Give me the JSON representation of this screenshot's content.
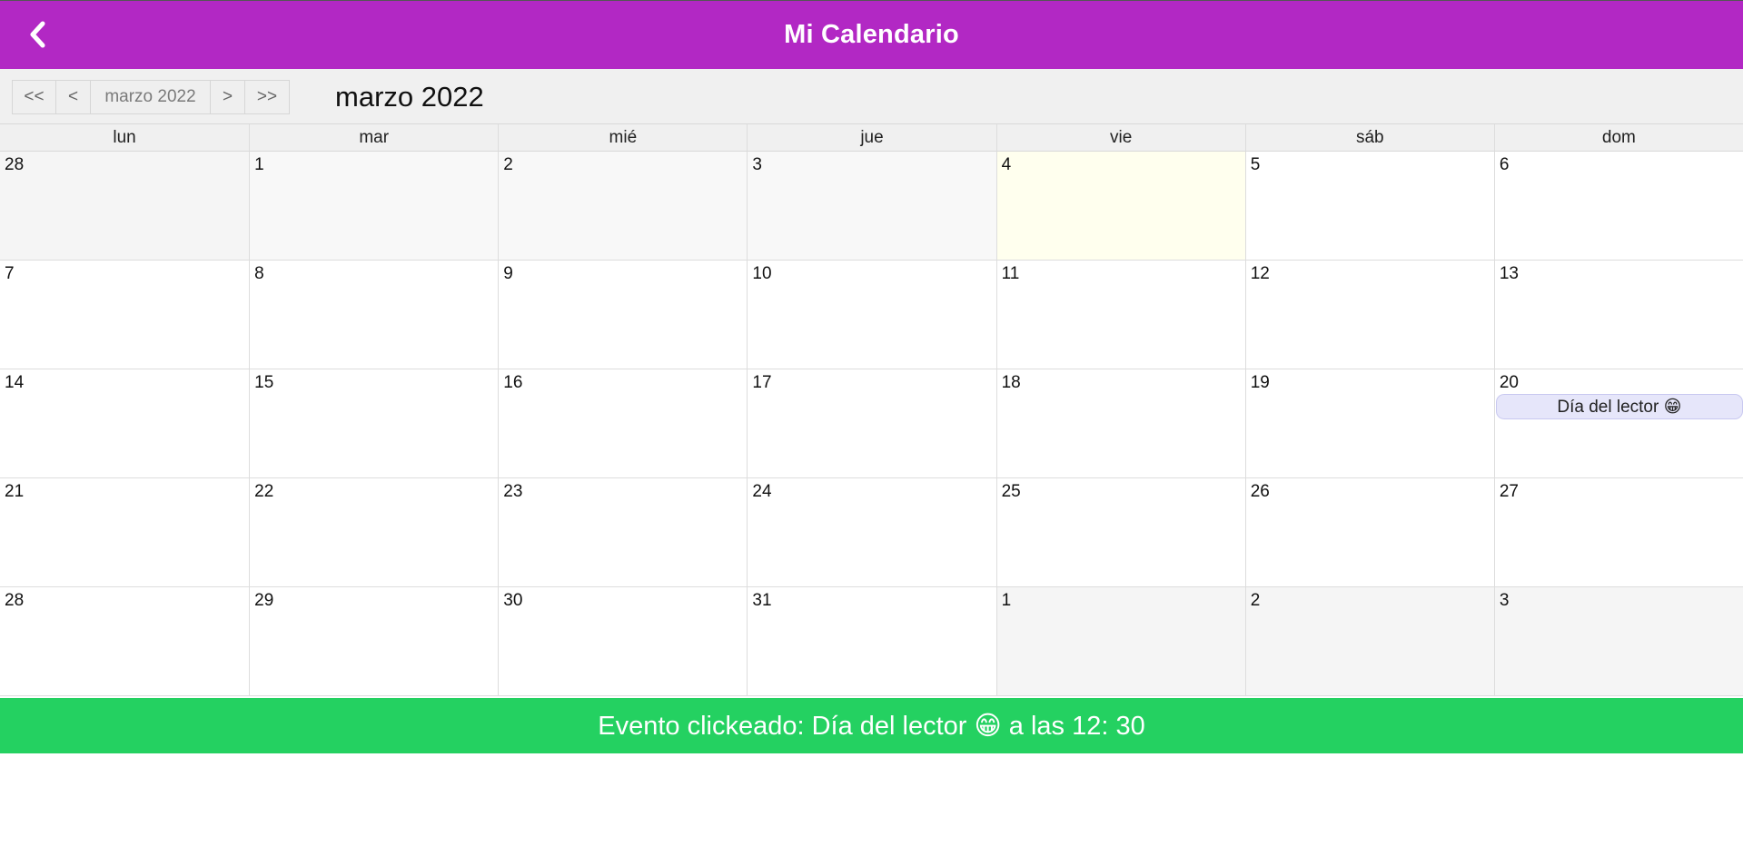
{
  "colors": {
    "header_bg": "#b228c4",
    "status_bg": "#24d161",
    "event_bg": "#e6e6fa",
    "today_bg": "#ffffee"
  },
  "header": {
    "title": "Mi Calendario",
    "back_icon": "chevron-left-icon"
  },
  "toolbar": {
    "prev_year": "<<",
    "prev_month": "<",
    "current_label": "marzo 2022",
    "next_month": ">",
    "next_year": ">>",
    "month_title": "marzo 2022"
  },
  "calendar": {
    "weekdays": [
      "lun",
      "mar",
      "mié",
      "jue",
      "vie",
      "sáb",
      "dom"
    ],
    "weeks": [
      [
        {
          "day": "28",
          "state": "off-range"
        },
        {
          "day": "1",
          "state": "past"
        },
        {
          "day": "2",
          "state": "past"
        },
        {
          "day": "3",
          "state": "past"
        },
        {
          "day": "4",
          "state": "today"
        },
        {
          "day": "5",
          "state": "normal"
        },
        {
          "day": "6",
          "state": "normal"
        }
      ],
      [
        {
          "day": "7",
          "state": "normal"
        },
        {
          "day": "8",
          "state": "normal"
        },
        {
          "day": "9",
          "state": "normal"
        },
        {
          "day": "10",
          "state": "normal"
        },
        {
          "day": "11",
          "state": "normal"
        },
        {
          "day": "12",
          "state": "normal"
        },
        {
          "day": "13",
          "state": "normal"
        }
      ],
      [
        {
          "day": "14",
          "state": "normal"
        },
        {
          "day": "15",
          "state": "normal"
        },
        {
          "day": "16",
          "state": "normal"
        },
        {
          "day": "17",
          "state": "normal"
        },
        {
          "day": "18",
          "state": "normal"
        },
        {
          "day": "19",
          "state": "normal"
        },
        {
          "day": "20",
          "state": "normal",
          "event": "Día del lector 😁"
        }
      ],
      [
        {
          "day": "21",
          "state": "normal"
        },
        {
          "day": "22",
          "state": "normal"
        },
        {
          "day": "23",
          "state": "normal"
        },
        {
          "day": "24",
          "state": "normal"
        },
        {
          "day": "25",
          "state": "normal"
        },
        {
          "day": "26",
          "state": "normal"
        },
        {
          "day": "27",
          "state": "normal"
        }
      ],
      [
        {
          "day": "28",
          "state": "normal"
        },
        {
          "day": "29",
          "state": "normal"
        },
        {
          "day": "30",
          "state": "normal"
        },
        {
          "day": "31",
          "state": "normal"
        },
        {
          "day": "1",
          "state": "off-range"
        },
        {
          "day": "2",
          "state": "off-range"
        },
        {
          "day": "3",
          "state": "off-range"
        }
      ]
    ]
  },
  "status": {
    "message": "Evento clickeado: Día del lector 😁  a las 12: 30"
  }
}
